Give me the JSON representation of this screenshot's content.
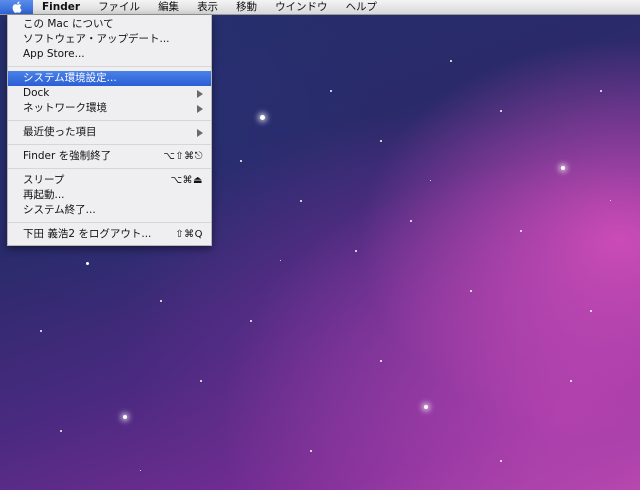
{
  "menubar": {
    "apple_icon": "apple-logo",
    "items": [
      "Finder",
      "ファイル",
      "編集",
      "表示",
      "移動",
      "ウインドウ",
      "ヘルプ"
    ]
  },
  "apple_menu": {
    "about": "この Mac について",
    "software_update": "ソフトウェア・アップデート...",
    "app_store": "App Store...",
    "system_prefs": "システム環境設定...",
    "dock": "Dock",
    "network_location": "ネットワーク環境",
    "recent_items": "最近使った項目",
    "force_quit": "Finder を強制終了",
    "force_quit_shortcut": "⌥⇧⌘⎋",
    "sleep": "スリープ",
    "sleep_shortcut": "⌥⌘⏏",
    "restart": "再起動...",
    "shutdown": "システム終了...",
    "logout": "下田 義浩2 をログアウト...",
    "logout_shortcut": "⇧⌘Q"
  },
  "colors": {
    "highlight": "#3a6fe0",
    "menu_bg": "#f6f6f6"
  }
}
